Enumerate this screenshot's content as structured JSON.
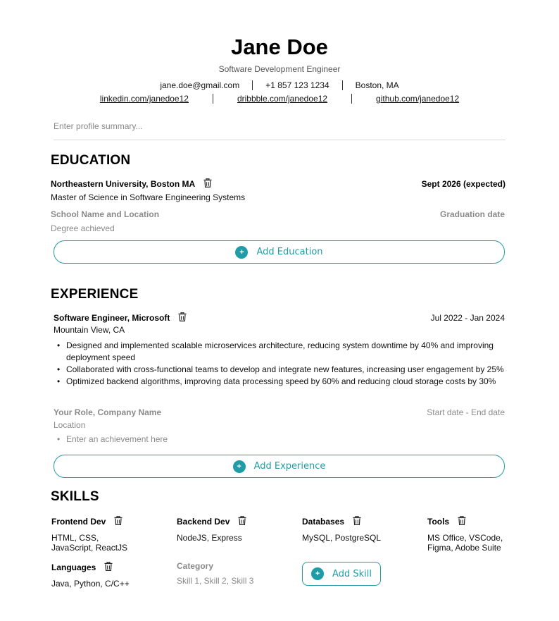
{
  "header": {
    "name": "Jane Doe",
    "subtitle": "Software Development Engineer",
    "email": "jane.doe@gmail.com",
    "phone": "+1 857 123 1234",
    "location": "Boston, MA",
    "links": [
      "linkedin.com/janedoe12",
      "dribbble.com/janedoe12",
      "github.com/janedoe12"
    ]
  },
  "summary": {
    "placeholder": "Enter profile summary..."
  },
  "education": {
    "title": "EDUCATION",
    "entry": {
      "school": "Northeastern University, Boston MA",
      "date": "Sept 2026 (expected)",
      "degree": "Master of Science in Software Engineering Systems"
    },
    "placeholder": {
      "school": "School Name and Location",
      "date": "Graduation date",
      "degree": "Degree achieved"
    },
    "add_label": "Add Education"
  },
  "experience": {
    "title": "EXPERIENCE",
    "entry": {
      "role": "Software Engineer, Microsoft",
      "dates": "Jul 2022 - Jan 2024",
      "location": "Mountain View, CA",
      "bullets": [
        "Designed and implemented scalable microservices architecture, reducing system downtime by 40% and improving deployment speed",
        "Collaborated with cross-functional teams to develop and integrate new features, increasing user engagement by 25%",
        "Optimized backend algorithms, improving data processing speed by 60% and reducing cloud storage costs by 30%"
      ]
    },
    "placeholder": {
      "role": "Your Role, Company Name",
      "dates": "Start date - End date",
      "location": "Location",
      "achievement": "Enter an achievement here"
    },
    "add_label": "Add Experience"
  },
  "skills": {
    "title": "SKILLS",
    "items": [
      {
        "label": "Frontend Dev",
        "value": "HTML, CSS, JavaScript, ReactJS"
      },
      {
        "label": "Backend Dev",
        "value": "NodeJS, Express"
      },
      {
        "label": "Databases",
        "value": "MySQL, PostgreSQL"
      },
      {
        "label": "Tools",
        "value": "MS Office, VSCode, Figma, Adobe Suite"
      },
      {
        "label": "Languages",
        "value": "Java, Python, C/C++"
      }
    ],
    "placeholder": {
      "label": "Category",
      "value": "Skill 1, Skill 2, Skill 3"
    },
    "add_label": "Add Skill"
  },
  "colors": {
    "accent": "#1f9ca6"
  },
  "icons": {
    "delete": "trash-icon",
    "add": "plus-circle-icon"
  }
}
